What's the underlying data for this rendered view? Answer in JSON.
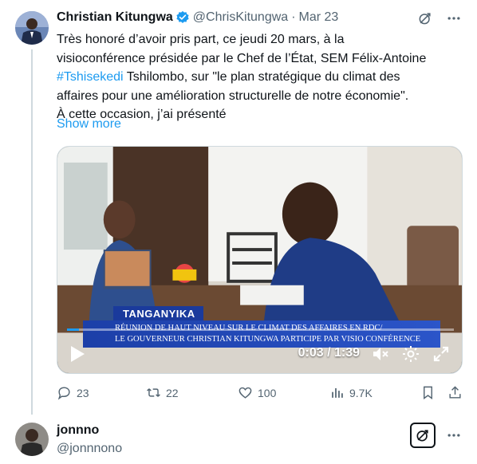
{
  "tweet": {
    "author_name": "Christian Kitungwa",
    "handle": "@ChrisKitungwa",
    "separator": "·",
    "date": "Mar 23",
    "text_lines": [
      "Très honoré d’avoir pris part, ce jeudi 20 mars, à la",
      "visioconférence présidée par le Chef de l’État, SEM Félix-Antoine"
    ],
    "hashtag": "#Tshisekedi",
    "text_line3_rest": " Tshilombo, sur \"le plan stratégique du climat des",
    "text_line4": "affaires pour une amélioration structurelle de notre économie\".",
    "text_line5": "À cette occasion, j’ai présenté",
    "show_more": "Show more"
  },
  "video": {
    "location_tag": "TANGANYIKA",
    "banner_line1": "RÉUNION DE HAUT NIVEAU SUR LE CLIMAT DES AFFAIRES EN RDC/",
    "banner_line2": "LE GOUVERNEUR CHRISTIAN KITUNGWA PARTICIPE PAR VISIO CONFÉRENCE",
    "time": "0:03 / 1:39",
    "progress_fraction": 0.03,
    "accent_color": "#1d9bf0"
  },
  "actions": {
    "replies": "23",
    "retweets": "22",
    "likes": "100",
    "views": "9.7K"
  },
  "reply": {
    "name": "jonnno",
    "handle": "@jonnnono"
  },
  "icons": {
    "verified": "verified-badge-icon",
    "grok": "grok-icon",
    "more": "more-icon",
    "reply": "reply-icon",
    "retweet": "retweet-icon",
    "like": "heart-icon",
    "views": "views-icon",
    "bookmark": "bookmark-icon",
    "share": "share-icon"
  },
  "colors": {
    "text": "#0f1419",
    "secondary": "#536471",
    "link": "#1d9bf0",
    "verified": "#1d9bf0",
    "banner": "#1c3fa8"
  }
}
